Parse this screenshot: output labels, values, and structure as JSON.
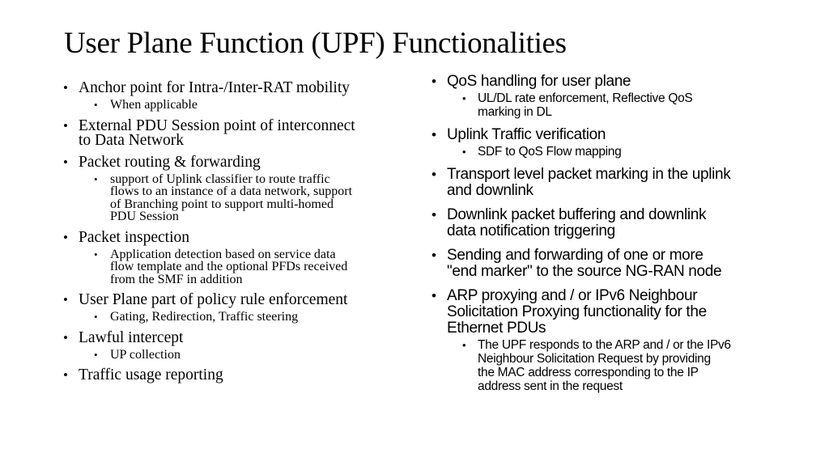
{
  "slide": {
    "title": "User Plane Function (UPF) Functionalities",
    "bullet_glyph": "•",
    "left_column": [
      {
        "level": 1,
        "text": "Anchor point for Intra-/Inter-RAT mobility"
      },
      {
        "level": 2,
        "text": "When applicable"
      },
      {
        "level": 1,
        "text": "External PDU Session point of interconnect\nto Data Network"
      },
      {
        "level": 1,
        "text": "Packet routing & forwarding"
      },
      {
        "level": 2,
        "text": "support of Uplink classifier to route traffic\nflows to an instance of a data network, support\nof Branching point to support multi-homed\nPDU Session"
      },
      {
        "level": 1,
        "text": "Packet inspection"
      },
      {
        "level": 2,
        "text": "Application detection based on service data\nflow template and the optional PFDs received\nfrom the SMF in addition"
      },
      {
        "level": 1,
        "text": "User Plane part of policy rule enforcement"
      },
      {
        "level": 2,
        "text": "Gating, Redirection, Traffic steering"
      },
      {
        "level": 1,
        "text": "Lawful intercept"
      },
      {
        "level": 2,
        "text": "UP collection"
      },
      {
        "level": 1,
        "text": "Traffic usage reporting"
      }
    ],
    "right_column": [
      {
        "level": 1,
        "text": "QoS handling for user plane"
      },
      {
        "level": 2,
        "text": "UL/DL rate enforcement, Reflective QoS\nmarking in DL"
      },
      {
        "level": 1,
        "text": "Uplink Traffic verification"
      },
      {
        "level": 2,
        "text": "SDF to QoS Flow mapping"
      },
      {
        "level": 1,
        "text": "Transport level packet marking in the uplink\nand downlink"
      },
      {
        "level": 1,
        "text": "Downlink packet buffering and downlink\ndata notification triggering"
      },
      {
        "level": 1,
        "text": "Sending and forwarding of one or more\n\"end marker\" to the source NG-RAN node"
      },
      {
        "level": 1,
        "text": "ARP proxying and / or IPv6 Neighbour\nSolicitation Proxying functionality for the\nEthernet PDUs"
      },
      {
        "level": 2,
        "text": "The UPF responds to the ARP and / or the IPv6\nNeighbour Solicitation Request by providing\nthe MAC address corresponding to the IP\naddress sent in the request"
      }
    ]
  }
}
